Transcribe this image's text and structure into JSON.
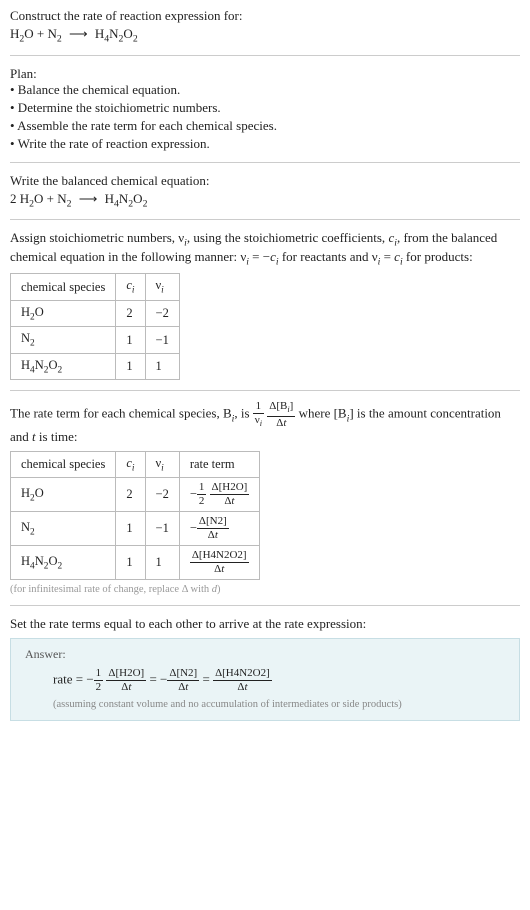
{
  "heading": "Construct the rate of reaction expression for:",
  "eq_unbalanced_html": "H<span class='sub'>2</span>O + N<span class='sub'>2</span> <span class='arrow'>⟶</span> H<span class='sub'>4</span>N<span class='sub'>2</span>O<span class='sub'>2</span>",
  "plan_title": "Plan:",
  "plan_items": [
    "• Balance the chemical equation.",
    "• Determine the stoichiometric numbers.",
    "• Assemble the rate term for each chemical species.",
    "• Write the rate of reaction expression."
  ],
  "balanced_title": "Write the balanced chemical equation:",
  "eq_balanced_html": "2 H<span class='sub'>2</span>O + N<span class='sub'>2</span> <span class='arrow'>⟶</span> H<span class='sub'>4</span>N<span class='sub'>2</span>O<span class='sub'>2</span>",
  "assign_text_html": "Assign stoichiometric numbers, ν<span class='sub ital'>i</span>, using the stoichiometric coefficients, <span class='ital'>c</span><span class='sub ital'>i</span>, from the balanced chemical equation in the following manner: ν<span class='sub ital'>i</span> = −<span class='ital'>c</span><span class='sub ital'>i</span> for reactants and ν<span class='sub ital'>i</span> = <span class='ital'>c</span><span class='sub ital'>i</span> for products:",
  "tbl1_headers": {
    "h1": "chemical species",
    "h2_html": "<span class='ital'>c</span><span class='sub ital'>i</span>",
    "h3_html": "ν<span class='sub ital'>i</span>"
  },
  "tbl1_rows": [
    {
      "sp_html": "H<span class='sub'>2</span>O",
      "c": "2",
      "nu": "−2"
    },
    {
      "sp_html": "N<span class='sub'>2</span>",
      "c": "1",
      "nu": "−1"
    },
    {
      "sp_html": "H<span class='sub'>4</span>N<span class='sub'>2</span>O<span class='sub'>2</span>",
      "c": "1",
      "nu": "1"
    }
  ],
  "rate_term_text_html": "The rate term for each chemical species, B<span class='sub ital'>i</span>, is <span class='frac'><span class='num'>1</span><span class='den'>ν<span class='sub ital'>i</span></span></span> <span class='frac'><span class='num'>Δ[B<span class='sub ital'>i</span>]</span><span class='den'>Δ<span class='ital'>t</span></span></span> where [B<span class='sub ital'>i</span>] is the amount concentration and <span class='ital'>t</span> is time:",
  "tbl2_headers": {
    "h1": "chemical species",
    "h2_html": "<span class='ital'>c</span><span class='sub ital'>i</span>",
    "h3_html": "ν<span class='sub ital'>i</span>",
    "h4": "rate term"
  },
  "tbl2_rows": [
    {
      "sp_html": "H<span class='sub'>2</span>O",
      "c": "2",
      "nu": "−2",
      "rt_html": "−<span class='frac'><span class='num'>1</span><span class='den'>2</span></span> <span class='frac'><span class='num'>Δ[H2O]</span><span class='den'>Δ<span class='ital'>t</span></span></span>"
    },
    {
      "sp_html": "N<span class='sub'>2</span>",
      "c": "1",
      "nu": "−1",
      "rt_html": "−<span class='frac'><span class='num'>Δ[N2]</span><span class='den'>Δ<span class='ital'>t</span></span></span>"
    },
    {
      "sp_html": "H<span class='sub'>4</span>N<span class='sub'>2</span>O<span class='sub'>2</span>",
      "c": "1",
      "nu": "1",
      "rt_html": "<span class='frac'><span class='num'>Δ[H4N2O2]</span><span class='den'>Δ<span class='ital'>t</span></span></span>"
    }
  ],
  "tbl2_caption_html": "(for infinitesimal rate of change, replace Δ with <span class='ital'>d</span>)",
  "set_equal_text": "Set the rate terms equal to each other to arrive at the rate expression:",
  "answer_label": "Answer:",
  "answer_expr_html": "rate = −<span class='frac'><span class='num'>1</span><span class='den'>2</span></span> <span class='frac'><span class='num'>Δ[H2O]</span><span class='den'>Δ<span class='ital'>t</span></span></span> = −<span class='frac'><span class='num'>Δ[N2]</span><span class='den'>Δ<span class='ital'>t</span></span></span> = <span class='frac'><span class='num'>Δ[H4N2O2]</span><span class='den'>Δ<span class='ital'>t</span></span></span>",
  "answer_note": "(assuming constant volume and no accumulation of intermediates or side products)"
}
